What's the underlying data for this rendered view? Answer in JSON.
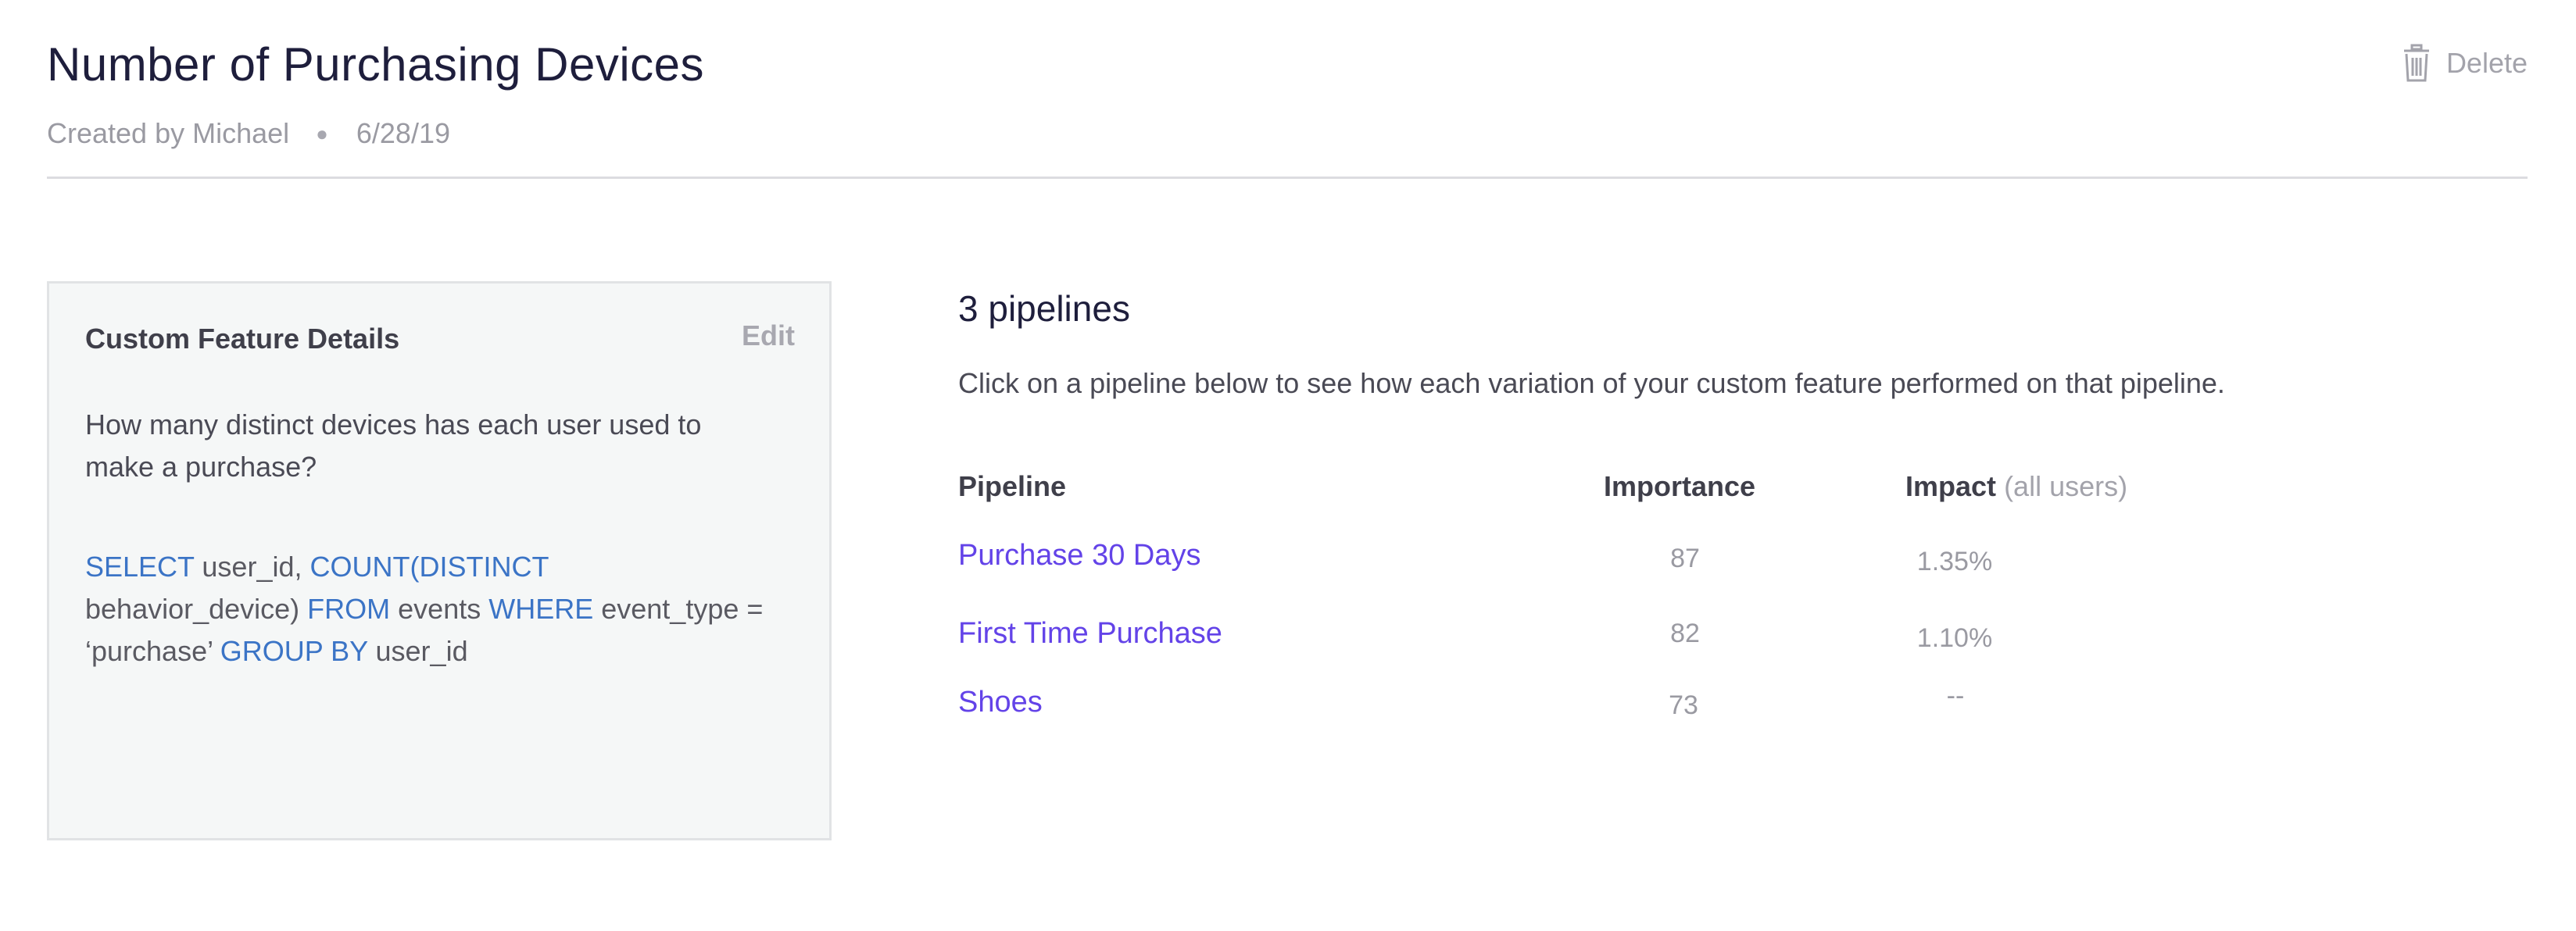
{
  "header": {
    "title": "Number of Purchasing Devices",
    "created_by": "Created by Michael",
    "separator": "●",
    "date": "6/28/19",
    "delete_label": "Delete",
    "delete_icon": "trash-icon"
  },
  "feature_card": {
    "title": "Custom Feature Details",
    "edit_label": "Edit",
    "description": "How many distinct devices has each user used to make a purchase?",
    "sql_tokens": [
      {
        "text": "SELECT",
        "kw": true
      },
      {
        "text": " user_id, ",
        "kw": false
      },
      {
        "text": "COUNT(DISTINCT",
        "kw": true
      },
      {
        "text": " behavior_device) ",
        "kw": false
      },
      {
        "text": "FROM",
        "kw": true
      },
      {
        "text": " events ",
        "kw": false
      },
      {
        "text": "WHERE",
        "kw": true
      },
      {
        "text": " event_type = ‘purchase’ ",
        "kw": false
      },
      {
        "text": "GROUP BY",
        "kw": true
      },
      {
        "text": " user_id",
        "kw": false
      }
    ]
  },
  "pipelines": {
    "title": "3 pipelines",
    "description": "Click on a pipeline below to see how each variation of your custom feature performed on that pipeline.",
    "columns": {
      "pipeline": "Pipeline",
      "importance": "Importance",
      "impact": "Impact",
      "impact_sub": "(all users)"
    },
    "rows": [
      {
        "name": "Purchase 30 Days",
        "importance": "87",
        "impact": "1.35%"
      },
      {
        "name": "First Time Purchase",
        "importance": "82",
        "impact": "1.10%"
      },
      {
        "name": "Shoes",
        "importance": "73",
        "impact": "--"
      }
    ]
  },
  "colors": {
    "title": "#1e1e3c",
    "link": "#6343e8",
    "sql_keyword": "#3b74c6",
    "muted": "#9a9aa2",
    "card_bg": "#f5f7f7"
  }
}
